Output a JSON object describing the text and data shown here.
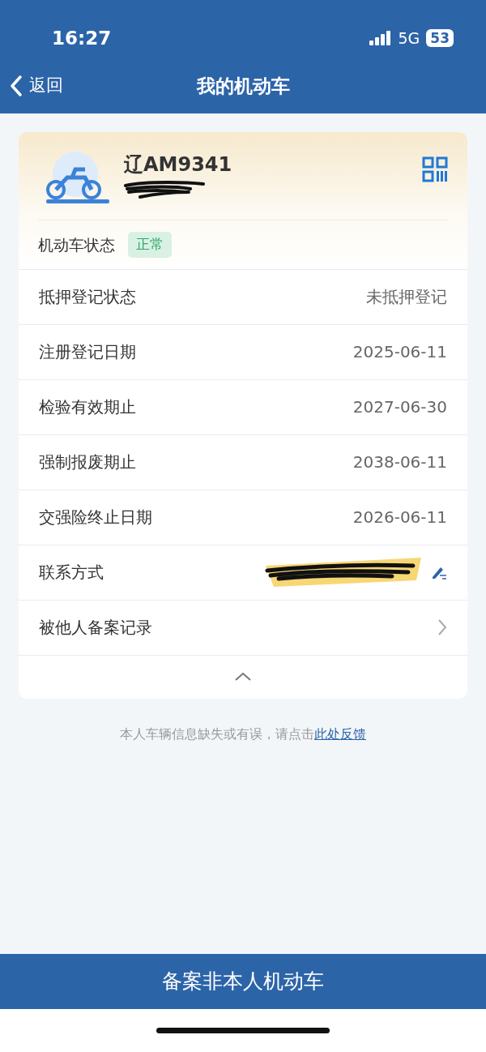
{
  "status_bar": {
    "time": "16:27",
    "network": "5G",
    "battery": "53"
  },
  "nav": {
    "back": "返回",
    "title": "我的机动车"
  },
  "vehicle": {
    "plate": "辽AM9341",
    "status_label": "机动车状态",
    "status": "正常"
  },
  "rows": [
    {
      "kind": "value",
      "label": "抵押登记状态",
      "value": "未抵押登记"
    },
    {
      "kind": "value",
      "label": "注册登记日期",
      "value": "2025-06-11"
    },
    {
      "kind": "value",
      "label": "检验有效期止",
      "value": "2027-06-30"
    },
    {
      "kind": "value",
      "label": "强制报废期止",
      "value": "2038-06-11"
    },
    {
      "kind": "value",
      "label": "交强险终止日期",
      "value": "2026-06-11"
    },
    {
      "kind": "edit",
      "label": "联系方式"
    },
    {
      "kind": "link",
      "label": "被他人备案记录"
    }
  ],
  "feedback": {
    "text": "本人车辆信息缺失或有误，请点击",
    "link": "此处反馈"
  },
  "action": "备案非本人机动车"
}
